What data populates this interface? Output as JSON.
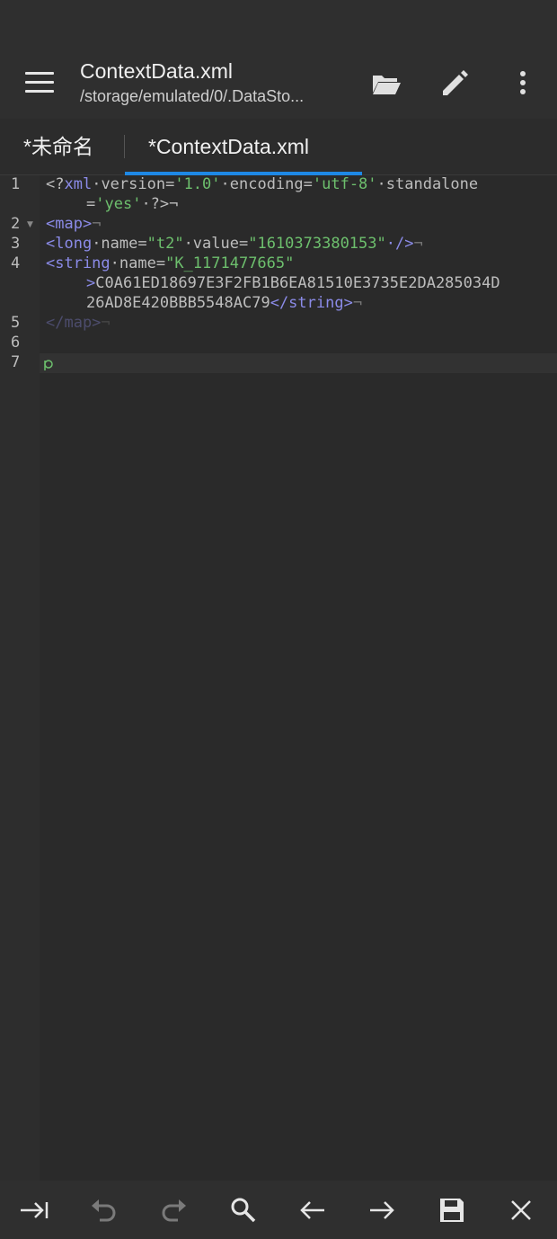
{
  "toolbar": {
    "title": "ContextData.xml",
    "path": "/storage/emulated/0/.DataSto...",
    "icons": [
      "menu-icon",
      "folder-open-icon",
      "pencil-icon",
      "more-vert-icon"
    ]
  },
  "tabs": [
    {
      "label": "*未命名",
      "active": false
    },
    {
      "label": "*ContextData.xml",
      "active": true
    }
  ],
  "editor": {
    "line_numbers": [
      "1",
      "2",
      "3",
      "4",
      "5",
      "6",
      "7"
    ],
    "line1a": {
      "t1": "<?",
      "t2": "xml",
      "t3": "·version=",
      "t4": "'1.0'",
      "t5": "·encoding=",
      "t6": "'utf-8'",
      "t7": "·standalone"
    },
    "line1b": {
      "t1": "=",
      "t2": "'yes'",
      "t3": "·?>¬"
    },
    "line2": {
      "t1": "<map>",
      "t2": "¬"
    },
    "line3": {
      "t1": "<long",
      "t2": "·name=",
      "t3": "\"t2\"",
      "t4": "·value=",
      "t5": "\"1610373380153\"",
      "t6": "·/>",
      "t7": "¬"
    },
    "line4a": {
      "t1": "<string",
      "t2": "·name=",
      "t3": "\"K_1171477665\""
    },
    "line4b": {
      "t1": ">",
      "t2": "C0A61ED18697E3F2FB1B6EA81510E3735E2DA285034D"
    },
    "line4c": {
      "t1": "26AD8E420BBB5548AC79",
      "t2": "</string>",
      "t3": "¬"
    },
    "line5": {
      "t1": "</map>",
      "t2": "¬"
    }
  },
  "bottom_bar": {
    "icons": [
      "tab-indent-icon",
      "undo-icon",
      "redo-icon",
      "search-icon",
      "arrow-left-icon",
      "arrow-right-icon",
      "save-icon",
      "close-icon"
    ]
  },
  "colors": {
    "accent": "#1e88e5",
    "tag": "#8b8be8",
    "string": "#6dbf6d",
    "background": "#2a2a2a"
  }
}
